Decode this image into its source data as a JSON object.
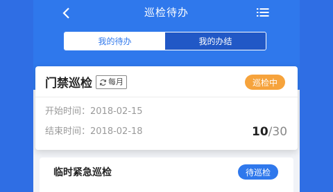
{
  "header": {
    "title": "巡检待办",
    "back_icon": "chevron-left-icon",
    "menu_icon": "list-menu-icon",
    "background": "#2f78ec"
  },
  "tabs": [
    {
      "label": "我的待办",
      "active": true
    },
    {
      "label": "我的办结",
      "active": false
    }
  ],
  "tasks": [
    {
      "name": "门禁巡检",
      "frequency": "每月",
      "status": "巡检中",
      "status_color": "#f6a33c",
      "start_label": "开始时间：",
      "start_date": "2018-02-15",
      "end_label": "结束时间：",
      "end_date": "2018-02-18",
      "progress_done": "10",
      "progress_total": "/30"
    },
    {
      "name": "临时紧急巡检",
      "status": "待巡检",
      "status_color": "#2f78ec"
    }
  ]
}
